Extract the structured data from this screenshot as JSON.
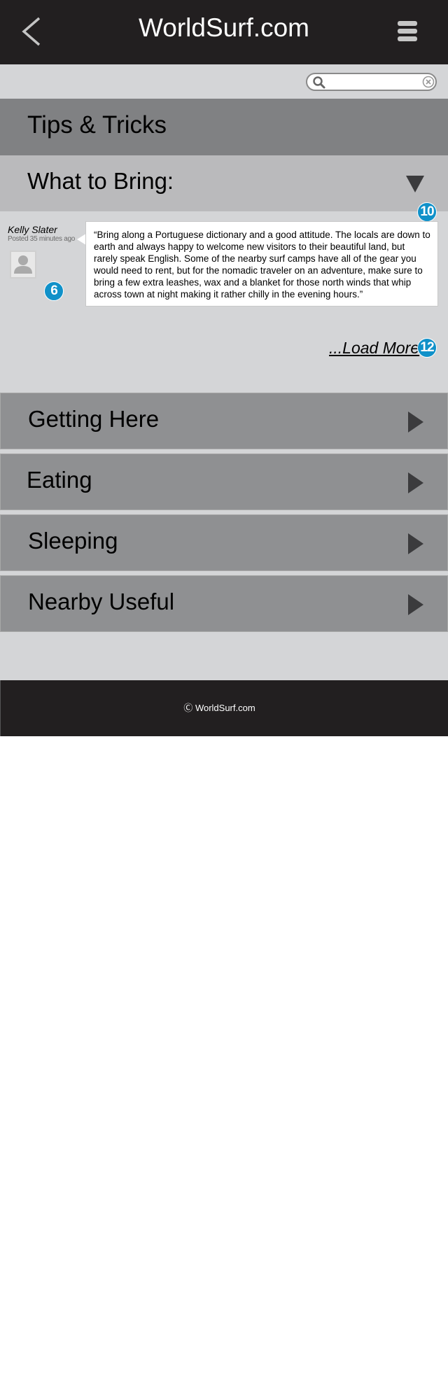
{
  "header": {
    "title": "WorldSurf.com"
  },
  "search": {
    "placeholder": ""
  },
  "section_header": {
    "title": "Tips & Tricks"
  },
  "expanded_section": {
    "title": "What to Bring:",
    "comment_count_badge": "10",
    "comment": {
      "author": "Kelly Slater",
      "posted": "Posted 35 minutes ago",
      "author_badge": "6",
      "text": "“Bring along a Portuguese dictionary and a good attitude. The locals are down to earth and always happy to welcome new visitors to their beautiful land, but rarely speak English. Some of the nearby surf camps have all of the gear you would need to rent, but for the nomadic traveler on an  adventure, make sure to bring a few extra leashes, wax and a blanket for those north winds that whip across town at night making it rather chilly in the evening hours.”"
    },
    "load_more": {
      "label": "...Load More",
      "badge": "12"
    }
  },
  "sections": [
    {
      "title": "Getting Here"
    },
    {
      "title": "Eating"
    },
    {
      "title": "Sleeping"
    },
    {
      "title": "Nearby Useful"
    }
  ],
  "footer": {
    "copyright": "Ⓒ WorldSurf.com"
  },
  "colors": {
    "header_bg": "#221f20",
    "page_bg": "#d4d5d7",
    "badge_blue": "#1091c9",
    "section_bg": "#8f9092",
    "tips_bg": "#808183",
    "expanded_bg": "#bababc"
  },
  "icons": {
    "back": "chevron-left-icon",
    "menu": "hamburger-menu-icon",
    "search": "search-icon",
    "clear": "clear-icon",
    "expanded": "triangle-down-icon",
    "collapsed": "triangle-right-icon",
    "avatar": "user-icon"
  }
}
